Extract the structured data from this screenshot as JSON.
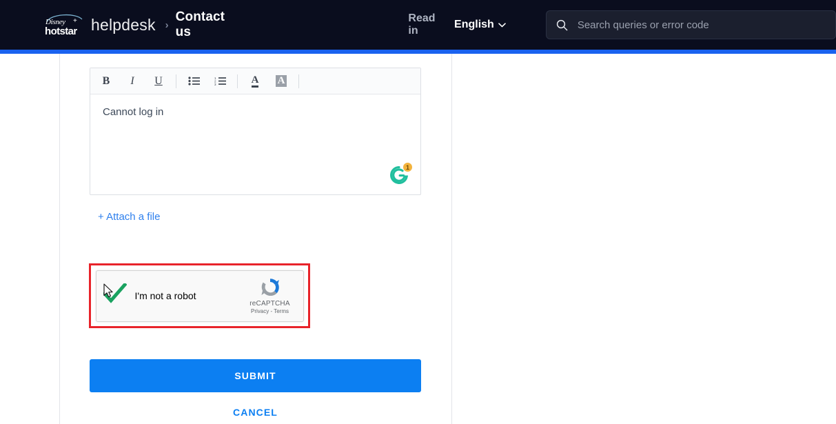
{
  "navbar": {
    "logo_alt": "Disney+ hotstar",
    "logo_disney_text": "Disney+",
    "logo_hotstar_text": "hotstar",
    "product": "helpdesk",
    "breadcrumb_separator": "›",
    "breadcrumb_current": "Contact us",
    "read_in_label": "Read in",
    "language_selected": "English",
    "language_chevron": "chevron-down",
    "search_placeholder": "Search queries or error code",
    "search_value": "",
    "search_icon": "search-icon",
    "bg_color": "#0a0d1e"
  },
  "progress": {
    "color": "#1a62ef",
    "percent": 100
  },
  "editor": {
    "toolbar": [
      {
        "name": "bold",
        "glyph": "B"
      },
      {
        "name": "italic",
        "glyph": "I"
      },
      {
        "name": "underline",
        "glyph": "U"
      },
      {
        "name": "bullet-list",
        "glyph": ""
      },
      {
        "name": "numbered-list",
        "glyph": ""
      },
      {
        "name": "text-color",
        "glyph": "A"
      },
      {
        "name": "highlight-color",
        "glyph": "A"
      }
    ],
    "bold_label": "B",
    "italic_label": "I",
    "underline_label": "U",
    "text_color_label": "A",
    "highlight_label": "A",
    "body_text": "Cannot log in",
    "grammarly_glyph": "G",
    "grammarly_badge_count": "1",
    "grammarly_color": "#21bf9e",
    "grammarly_badge_color": "#f3b33d"
  },
  "attach": {
    "label": "+ Attach a file",
    "color": "#2f80ed"
  },
  "recaptcha": {
    "label": "I'm not a robot",
    "checked": true,
    "check_color": "#1aa260",
    "brand_name": "reCAPTCHA",
    "brand_links": "Privacy - Terms",
    "annotation_color": "#e8232a"
  },
  "actions": {
    "submit_label": "SUBMIT",
    "cancel_label": "CANCEL",
    "primary_color": "#0c7ff2"
  }
}
